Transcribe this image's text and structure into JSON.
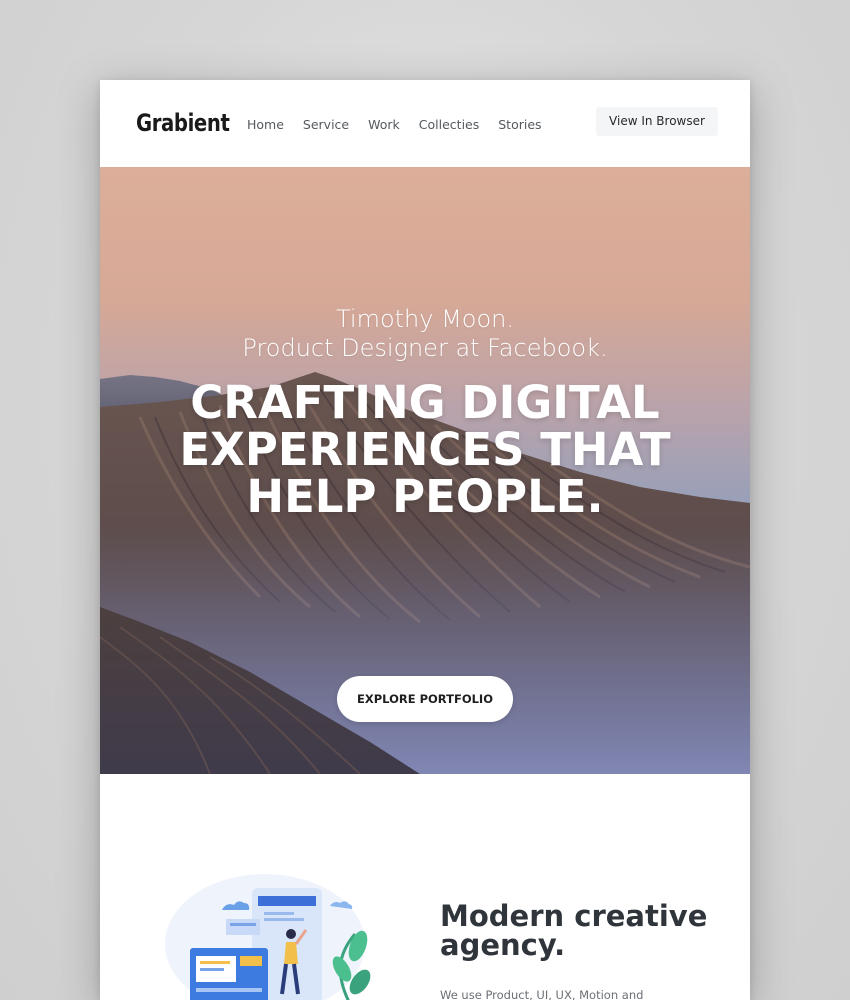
{
  "header": {
    "logo": "Grabient",
    "nav": [
      "Home",
      "Service",
      "Work",
      "Collecties",
      "Stories"
    ],
    "view_button": "View In Browser"
  },
  "hero": {
    "subtitle_line1": "Timothy Moon.",
    "subtitle_line2": "Product Designer at Facebook.",
    "title_lines": [
      "CRAFTING DIGITAL",
      "EXPERIENCES THAT",
      "HELP PEOPLE."
    ],
    "cta": "EXPLORE PORTFOLIO"
  },
  "about": {
    "title_lines": [
      "Modern creative",
      "agency."
    ],
    "text": "We use Product, UI, UX, Motion and"
  },
  "colors": {
    "hero_sky_top": "#dcaf9a",
    "hero_sky_bottom": "#8092c0",
    "heading_text": "#2f353b",
    "accent_blue": "#3d7be0"
  },
  "icons": {
    "illustration": "designer-at-screen-illustration"
  }
}
